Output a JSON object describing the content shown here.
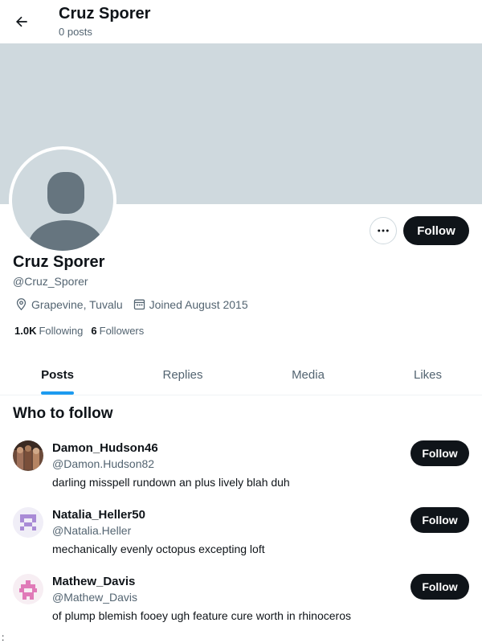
{
  "header": {
    "back_icon": "arrow-left-icon",
    "name": "Cruz Sporer",
    "posts_count": "0 posts"
  },
  "profile": {
    "name": "Cruz Sporer",
    "handle": "@Cruz_Sporer",
    "location": "Grapevine, Tuvalu",
    "joined": "Joined August 2015",
    "following_count": "1.0K",
    "following_label": "Following",
    "followers_count": "6",
    "followers_label": "Followers",
    "follow_label": "Follow",
    "more_icon": "more-horizontal-icon"
  },
  "tabs": [
    {
      "label": "Posts",
      "active": true
    },
    {
      "label": "Replies",
      "active": false
    },
    {
      "label": "Media",
      "active": false
    },
    {
      "label": "Likes",
      "active": false
    }
  ],
  "who_to_follow": {
    "title": "Who to follow",
    "users": [
      {
        "name": "Damon_Hudson46",
        "handle": "@Damon.Hudson82",
        "bio": "darling misspell rundown an plus lively blah duh",
        "follow_label": "Follow",
        "avatar": "photo-avatar"
      },
      {
        "name": "Natalia_Heller50",
        "handle": "@Natalia.Heller",
        "bio": "mechanically evenly octopus excepting loft",
        "follow_label": "Follow",
        "avatar": "pixel-avatar-purple"
      },
      {
        "name": "Mathew_Davis",
        "handle": "@Mathew_Davis",
        "bio": "of plump blemish fooey ugh feature cure worth in rhinoceros",
        "follow_label": "Follow",
        "avatar": "pixel-avatar-pink"
      }
    ]
  },
  "stray_mark": ":",
  "colors": {
    "banner": "#cfd9de",
    "accent": "#1d9bf0",
    "button": "#0f1419",
    "muted_text": "#536471"
  }
}
